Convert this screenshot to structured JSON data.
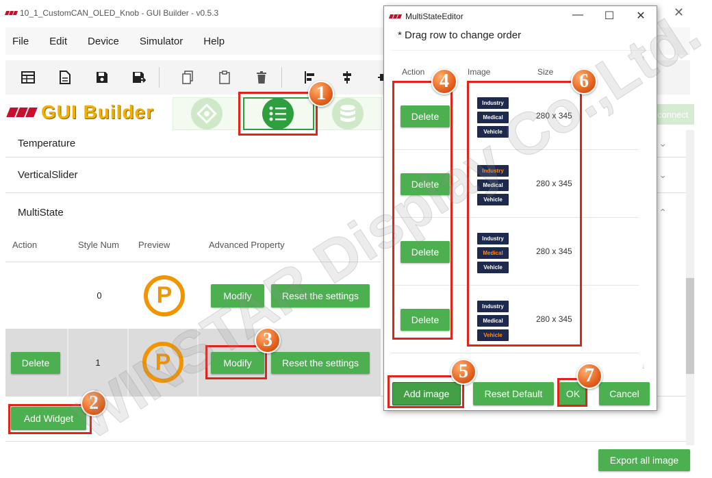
{
  "window": {
    "title": "10_1_CustomCAN_OLED_Knob - GUI Builder - v0.5.3",
    "close_glyph": "✕"
  },
  "menu": [
    "File",
    "Edit",
    "Device",
    "Simulator",
    "Help"
  ],
  "toolbar_icons": [
    "table-icon",
    "document-icon",
    "save-icon",
    "save-as-icon",
    "copy-icon",
    "paste-icon",
    "delete-icon",
    "align-left-icon",
    "align-center-icon",
    "align-middle-icon"
  ],
  "brand": {
    "text": "GUI Builder"
  },
  "connect_label": "connect",
  "accordion": {
    "temperature": "Temperature",
    "vertical_slider": "VerticalSlider",
    "multistate": "MultiState"
  },
  "chevrons": {
    "collapsed": "⌄",
    "expanded": "⌃"
  },
  "table": {
    "headers": [
      "Action",
      "Style Num",
      "Preview",
      "Advanced Property"
    ],
    "rows": [
      {
        "style_num": "0",
        "preview": "P",
        "modify": "Modify",
        "reset": "Reset the settings"
      },
      {
        "action": "Delete",
        "style_num": "1",
        "preview": "P",
        "modify": "Modify",
        "reset": "Reset the settings"
      }
    ]
  },
  "add_widget": "Add Widget",
  "export_all_image": "Export all image",
  "dialog": {
    "title": "MultiStateEditor",
    "controls": {
      "minimize": "—",
      "maximize": "☐",
      "close": "✕"
    },
    "hint": "* Drag row to change order",
    "headers": [
      "Action",
      "Image",
      "Size"
    ],
    "rows": [
      {
        "delete": "Delete",
        "tags": [
          "Industry",
          "Medical",
          "Vehicle"
        ],
        "highlight": -1,
        "size": "280 x 345"
      },
      {
        "delete": "Delete",
        "tags": [
          "Industry",
          "Medical",
          "Vehicle"
        ],
        "highlight": 0,
        "size": "280 x 345"
      },
      {
        "delete": "Delete",
        "tags": [
          "Industry",
          "Medical",
          "Vehicle"
        ],
        "highlight": 1,
        "size": "280 x 345"
      },
      {
        "delete": "Delete",
        "tags": [
          "Industry",
          "Medical",
          "Vehicle"
        ],
        "highlight": 2,
        "size": "280 x 345"
      }
    ],
    "scroll_arrows": {
      "up": "↑",
      "down": "↓"
    },
    "buttons": {
      "add_image": "Add image",
      "reset_default": "Reset Default",
      "ok": "OK",
      "cancel": "Cancel"
    }
  },
  "callouts": [
    "1",
    "2",
    "3",
    "4",
    "5",
    "6",
    "7"
  ],
  "watermark": "WINSTAR Display Co.,Ltd.",
  "colors": {
    "green": "#4caf50",
    "red_box": "#e2231a",
    "badge": "#e5621e",
    "tag_bg": "#1d2a4d",
    "tag_highlight": "#ff8a1e",
    "p_logo": "#f29400"
  }
}
